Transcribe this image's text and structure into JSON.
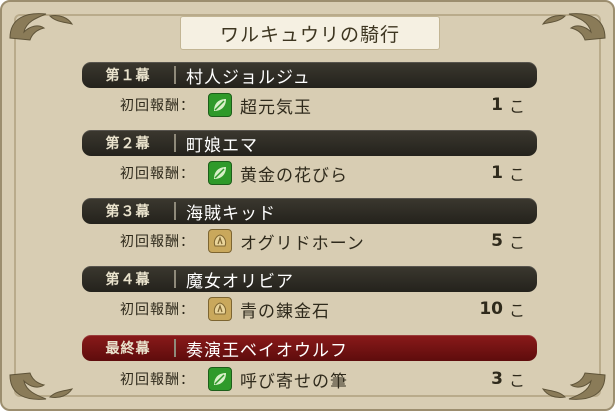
{
  "title": "ワルキュウリの騎行",
  "reward_label": "初回報酬：",
  "acts": [
    {
      "act": "第１幕",
      "name": "村人ジョルジュ",
      "reward_icon": "leaf-icon",
      "reward": "超元気玉",
      "qty": "1",
      "unit": "こ"
    },
    {
      "act": "第２幕",
      "name": "町娘エマ",
      "reward_icon": "leaf-icon",
      "reward": "黄金の花びら",
      "qty": "1",
      "unit": "こ"
    },
    {
      "act": "第３幕",
      "name": "海賊キッド",
      "reward_icon": "ore-icon",
      "reward": "オグリドホーン",
      "qty": "5",
      "unit": "こ"
    },
    {
      "act": "第４幕",
      "name": "魔女オリビア",
      "reward_icon": "ore-icon",
      "reward": "青の錬金石",
      "qty": "10",
      "unit": "こ"
    },
    {
      "act": "最終幕",
      "name": "奏演王ベイオウルフ",
      "reward_icon": "leaf-icon",
      "reward": "呼び寄せの筆",
      "qty": "3",
      "unit": "こ"
    }
  ],
  "colors": {
    "panel_bg": "#d8cdb3",
    "act_bar": "#2e2b24",
    "final_act_bar": "#7a1414",
    "leaf_icon": "#2f9a2a",
    "ore_icon": "#c9a85c"
  }
}
